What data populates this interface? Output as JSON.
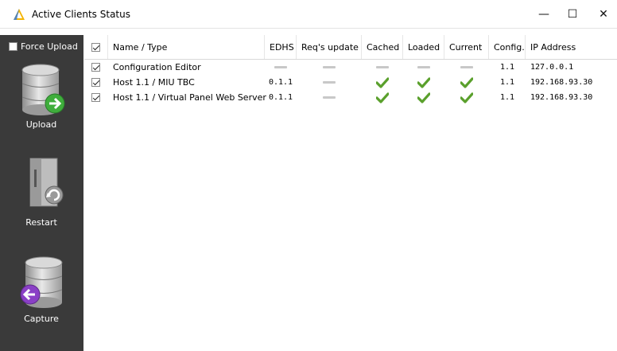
{
  "window": {
    "title": "Active Clients Status",
    "min_glyph": "—",
    "max_glyph": "☐",
    "close_glyph": "✕"
  },
  "sidebar": {
    "force_upload": "Force Upload",
    "buttons": [
      {
        "label": "Upload",
        "icon": "database-upload-icon"
      },
      {
        "label": "Restart",
        "icon": "server-restart-icon"
      },
      {
        "label": "Capture",
        "icon": "database-capture-icon"
      }
    ]
  },
  "table": {
    "columns": [
      "Name / Type",
      "EDHS",
      "Req's update",
      "Cached",
      "Loaded",
      "Current",
      "Config.",
      "IP Address"
    ],
    "rows": [
      {
        "name": "Configuration Editor",
        "edhs": "",
        "req_update": "dash",
        "cached": "dash",
        "loaded": "dash",
        "current": "dash",
        "config": "1.1",
        "ip": "127.0.0.1"
      },
      {
        "name": "Host 1.1 / MIU TBC",
        "edhs": "0.1.1",
        "req_update": "dash",
        "cached": "check",
        "loaded": "check",
        "current": "check",
        "config": "1.1",
        "ip": "192.168.93.30"
      },
      {
        "name": "Host 1.1 / Virtual Panel Web Server",
        "edhs": "0.1.1",
        "req_update": "dash",
        "cached": "check",
        "loaded": "check",
        "current": "check",
        "config": "1.1",
        "ip": "192.168.93.30"
      }
    ]
  },
  "colors": {
    "sidebar": "#3a3a3a",
    "check": "#5aa02c",
    "dash": "#c8c8c8",
    "upload_arrow": "#3fae3c",
    "capture_arrow": "#8a3fc6"
  }
}
